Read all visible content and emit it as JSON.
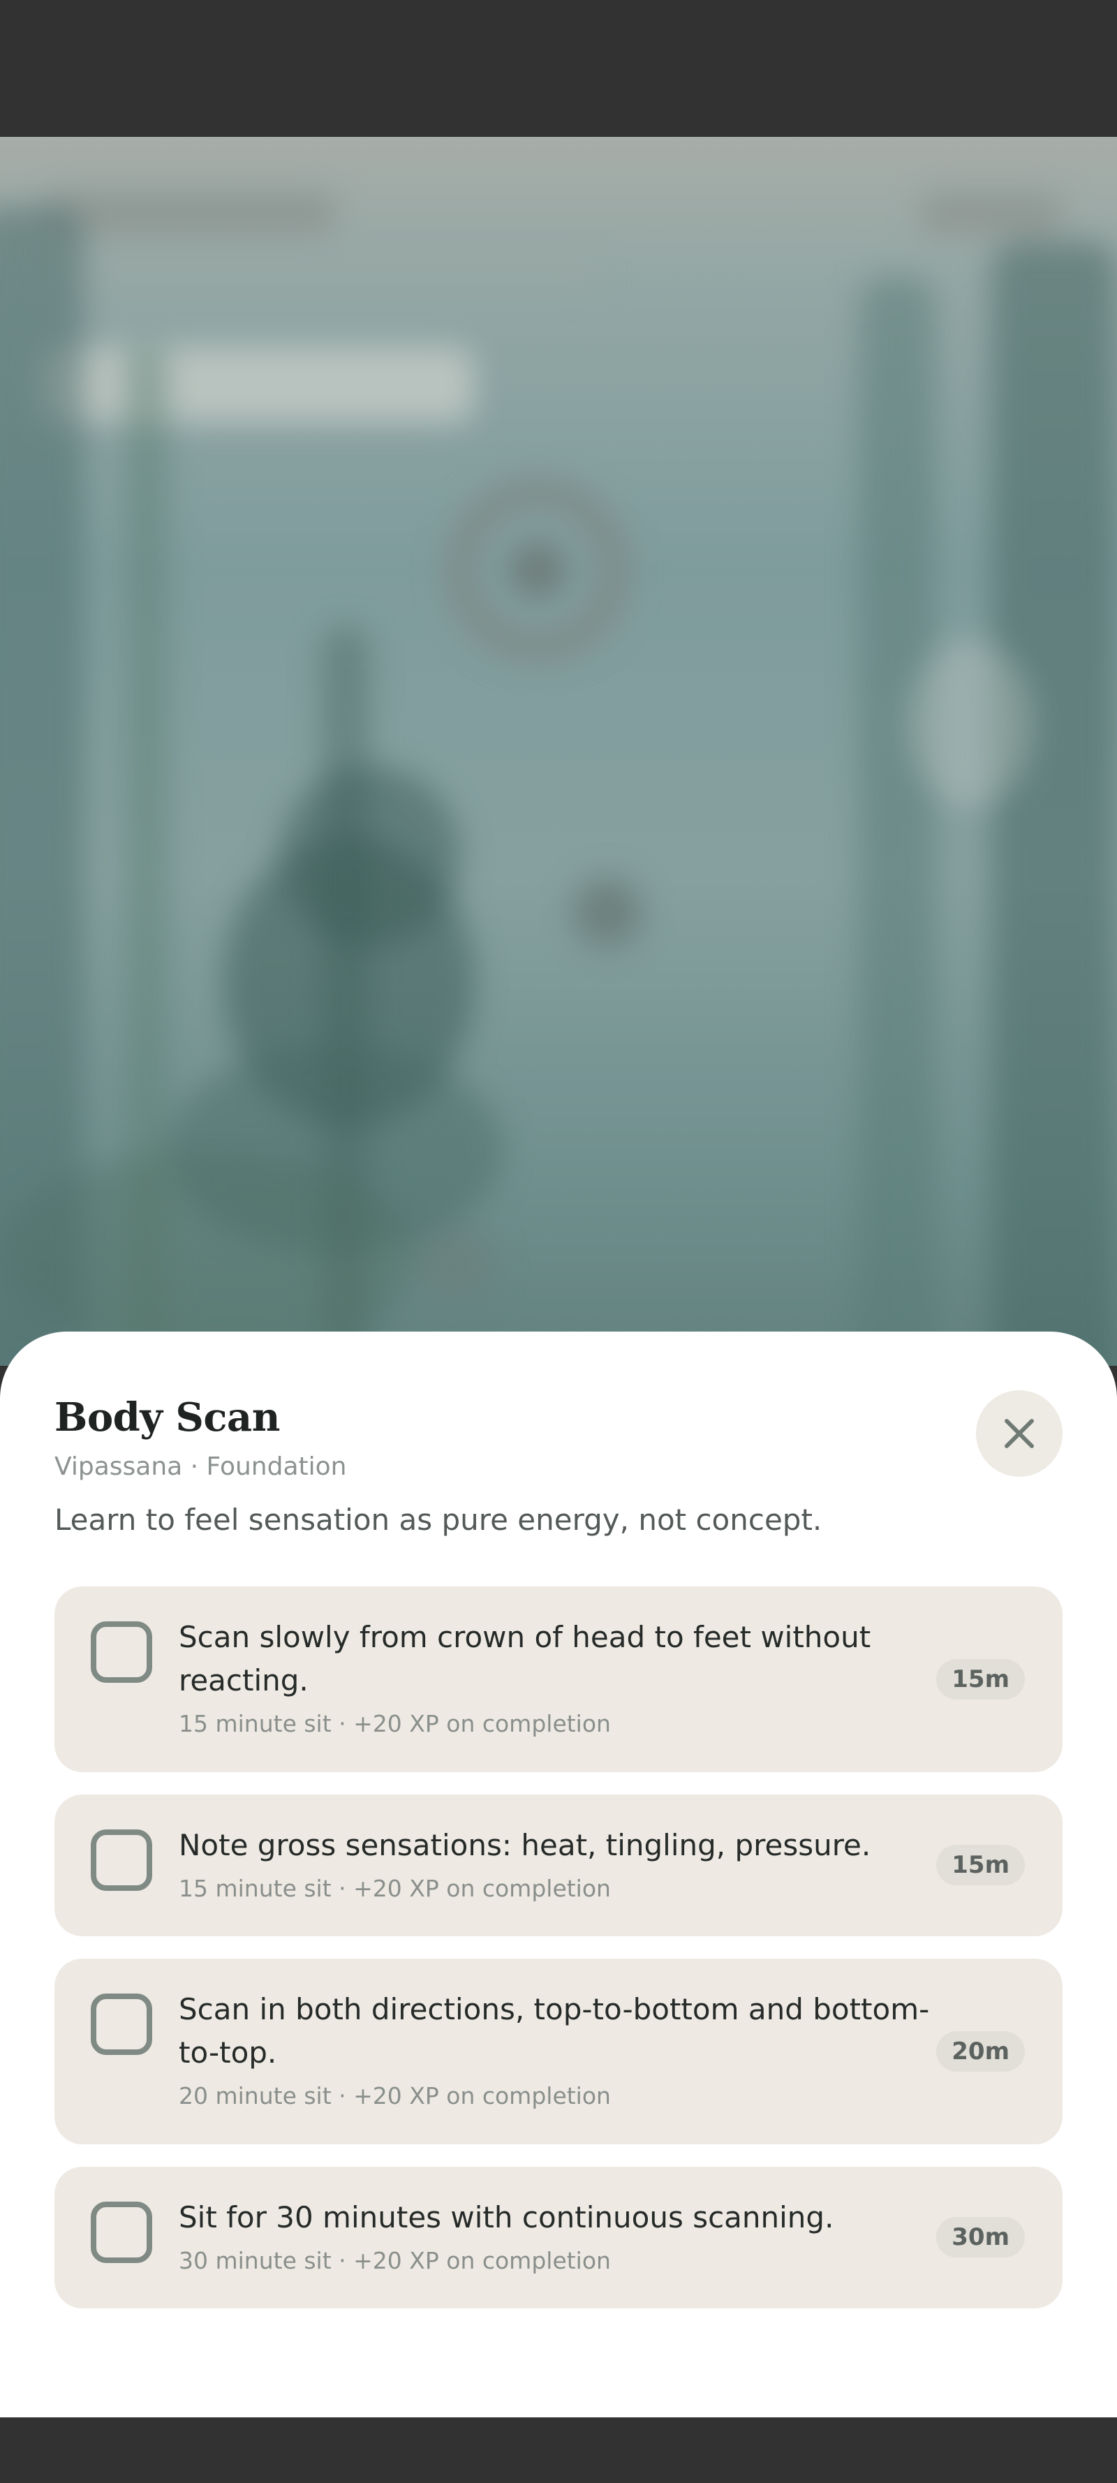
{
  "sheet": {
    "title": "Body Scan",
    "subtitle": "Vipassana · Foundation",
    "description": "Learn to feel sensation as pure energy, not concept.",
    "close_icon": "close-icon"
  },
  "tasks": [
    {
      "title": "Scan slowly from crown of head to feet without reacting.",
      "meta": "15 minute sit · +20 XP on completion",
      "duration": "15m",
      "checked": false
    },
    {
      "title": "Note gross sensations: heat, tingling, pressure.",
      "meta": "15 minute sit · +20 XP on completion",
      "duration": "15m",
      "checked": false
    },
    {
      "title": "Scan in both directions, top-to-bottom and bottom-to-top.",
      "meta": "20 minute sit · +20 XP on completion",
      "duration": "20m",
      "checked": false
    },
    {
      "title": "Sit for 30 minutes with continuous scanning.",
      "meta": "30 minute sit · +20 XP on completion",
      "duration": "30m",
      "checked": false
    }
  ],
  "colors": {
    "sheet_background": "#ffffff",
    "card_background": "#eeeae3",
    "checkbox_border": "#7f8a84",
    "chrome": "#323232"
  }
}
